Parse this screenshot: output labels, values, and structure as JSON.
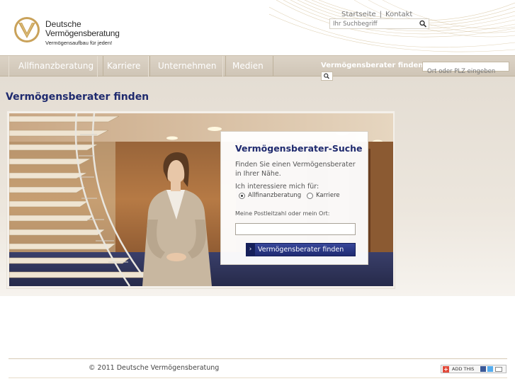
{
  "brand": {
    "name_line1": "Deutsche",
    "name_line2": "Vermögensberatung",
    "tagline": "Vermögensaufbau für jeden!"
  },
  "top_links": {
    "home": "Startseite",
    "separator": "|",
    "contact": "Kontakt"
  },
  "search": {
    "placeholder": "Ihr Suchbegriff",
    "icon": "search-icon"
  },
  "nav": {
    "items": [
      {
        "label": "Allfinanzberatung"
      },
      {
        "label": "Karriere"
      },
      {
        "label": "Unternehmen"
      },
      {
        "label": "Medien"
      }
    ],
    "find_label": "Vermögensberater finden",
    "find_placeholder": "Ort oder PLZ eingeben"
  },
  "main": {
    "page_title": "Vermögensberater finden"
  },
  "panel": {
    "title": "Vermögensberater-Suche",
    "description": "Finden Sie einen Vermögensberater in Ihrer Nähe.",
    "interest_label": "Ich interessiere mich für:",
    "options": [
      {
        "label": "Allfinanzberatung",
        "selected": true
      },
      {
        "label": "Karriere",
        "selected": false
      }
    ],
    "plz_label": "Meine Postleitzahl oder mein Ort:",
    "plz_value": "",
    "button_arrow": "›",
    "button_label": "Vermögensberater finden"
  },
  "footer": {
    "copyright": "© 2011 Deutsche Vermögensberatung",
    "addthis_plus": "+",
    "addthis_label": "ADD THIS"
  },
  "colors": {
    "brand_navy": "#1f2a6e",
    "nav_beige": "#d6cdbf",
    "logo_gold": "#c9a25a"
  }
}
